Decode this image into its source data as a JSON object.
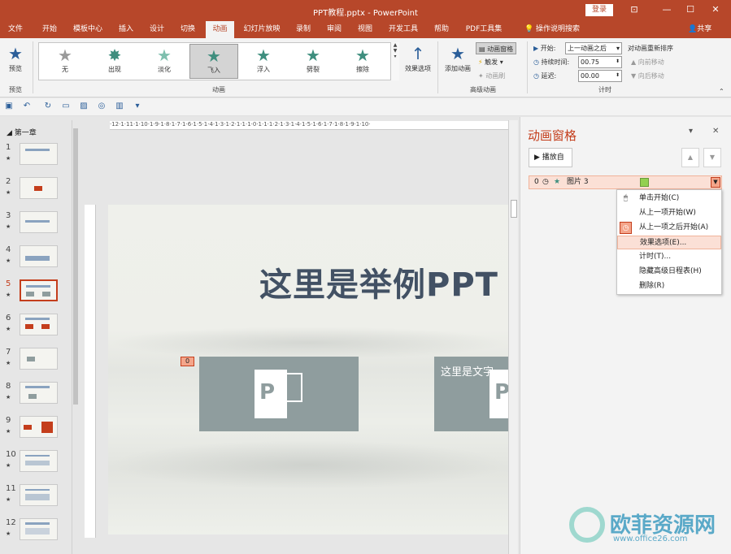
{
  "window": {
    "title": "PPT教程.pptx - PowerPoint",
    "login_label": "登录",
    "minimize": "—",
    "restore": "▢",
    "maximize": "☐",
    "close": "✕",
    "ribbon_display": "⊡"
  },
  "tabs": [
    "文件",
    "开始",
    "模板中心",
    "插入",
    "设计",
    "切换",
    "动画",
    "幻灯片放映",
    "录制",
    "审阅",
    "视图",
    "开发工具",
    "帮助",
    "PDF工具集"
  ],
  "active_tab": "动画",
  "tell_me": "操作说明搜索",
  "share_label": "共享",
  "ribbon": {
    "preview": {
      "label": "预览",
      "group": "预览"
    },
    "animations": [
      "无",
      "出现",
      "淡化",
      "飞入",
      "浮入",
      "劈裂",
      "擦除"
    ],
    "selected_animation": "飞入",
    "animation_group": "动画",
    "effect_options": "效果选项",
    "add_animation": "添加动画",
    "animation_pane_btn": "动画窗格",
    "trigger": "触发",
    "animation_painter": "动画刷",
    "advanced_group": "高级动画",
    "start_label": "开始:",
    "start_value": "上一动画之后",
    "duration_label": "持续时间:",
    "duration_value": "00.75",
    "delay_label": "延迟:",
    "delay_value": "00.00",
    "reorder_label": "对动画重新排序",
    "move_earlier": "向前移动",
    "move_later": "向后移动",
    "timing_group": "计时"
  },
  "slides_panel": {
    "section": "第一章",
    "slides": [
      "1",
      "2",
      "3",
      "4",
      "5",
      "6",
      "7",
      "8",
      "9",
      "10",
      "11",
      "12"
    ],
    "active_slide": "5"
  },
  "ruler": "·12·1·11·1·10·1·9·1·8·1·7·1·6·1·5·1·4·1·3·1·2·1·1·1·0·1·1·1·2·1·3·1·4·1·5·1·6·1·7·1·8·1·9·1·10·",
  "slide": {
    "title": "这里是举例PPT",
    "anim_tag": "0",
    "image_text": "这里是文字"
  },
  "pane": {
    "title": "动画窗格",
    "play_label": "播放自",
    "item": {
      "order": "0",
      "name": "图片 3"
    },
    "menu": [
      {
        "label": "单击开始(C)"
      },
      {
        "label": "从上一项开始(W)"
      },
      {
        "label": "从上一项之后开始(A)"
      },
      {
        "label": "效果选项(E)..."
      },
      {
        "label": "计时(T)..."
      },
      {
        "label": "隐藏高级日程表(H)"
      },
      {
        "label": "删除(R)"
      }
    ]
  },
  "watermark": {
    "brand": "欧菲资源网",
    "url": "www.office26.com"
  }
}
